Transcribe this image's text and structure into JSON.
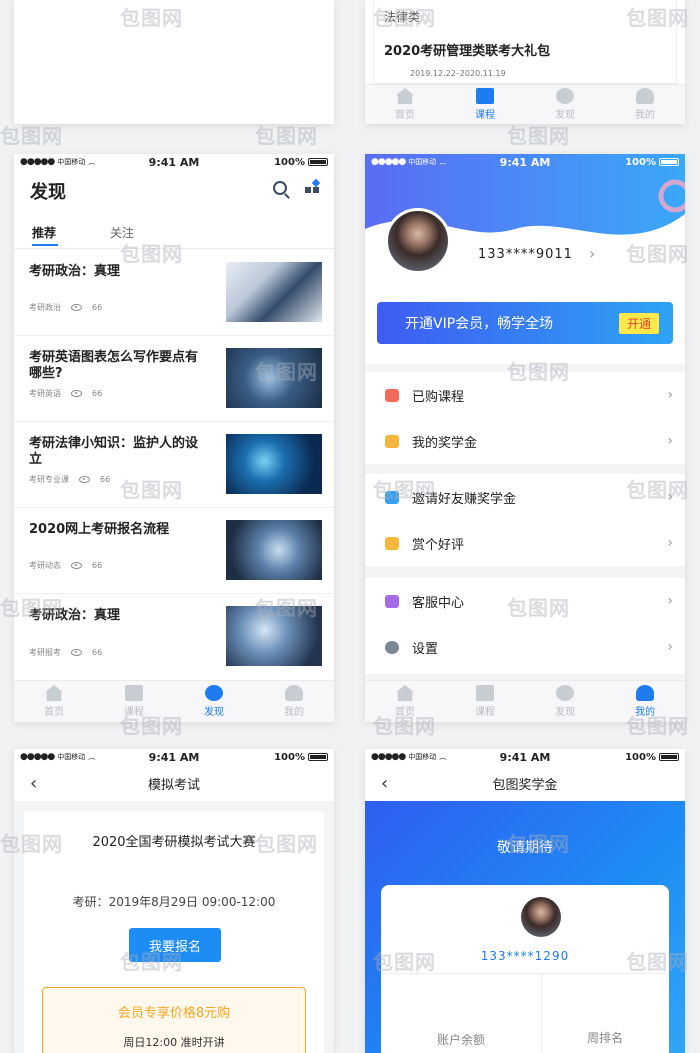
{
  "watermark": "包图网",
  "status": {
    "carrier": "中国移动",
    "time": "9:41 AM",
    "battery": "100%"
  },
  "tabs": [
    "首页",
    "课程",
    "发现",
    "我的"
  ],
  "panel_top_right": {
    "category": "法律类",
    "title": "2020考研管理类联考大礼包",
    "dates": "2019.12.22–2020.11.19"
  },
  "discover": {
    "title": "发现",
    "tabs": [
      "推荐",
      "关注"
    ],
    "articles": [
      {
        "title": "考研政治：真理",
        "tag": "考研政治",
        "views": "66"
      },
      {
        "title": "考研英语图表怎么写作要点有哪些?",
        "tag": "考研英语",
        "views": "66"
      },
      {
        "title": "考研法律小知识：监护人的设立",
        "tag": "考研专业课",
        "views": "66"
      },
      {
        "title": "2020网上考研报名流程",
        "tag": "考研动态",
        "views": "66"
      },
      {
        "title": "考研政治：真理",
        "tag": "考研报考",
        "views": "66"
      }
    ]
  },
  "profile": {
    "phone": "133****9011",
    "vip_text": "开通VIP会员，畅学全场",
    "vip_button": "开通",
    "menu": [
      {
        "label": "已购课程",
        "icon": "book-icon",
        "color": "#f26b5b"
      },
      {
        "label": "我的奖学金",
        "icon": "graduation-cap-icon",
        "color": "#f4b63d"
      },
      {
        "label": "邀请好友赚奖学金",
        "icon": "gift-icon",
        "color": "#3aa0f0"
      },
      {
        "label": "赏个好评",
        "icon": "thumb-up-icon",
        "color": "#f4b63d"
      },
      {
        "label": "客服中心",
        "icon": "headset-icon",
        "color": "#a66be8"
      },
      {
        "label": "设置",
        "icon": "gear-icon",
        "color": "#7c8694"
      }
    ]
  },
  "exam": {
    "nav_title": "模拟考试",
    "title": "2020全国考研模拟考试大赛",
    "date_line": "考研：2019年8月29日 09:00-12:00",
    "signup": "我要报名",
    "member_price": "会员专享价格8元购",
    "open_time": "周日12:00 准时开讲"
  },
  "scholarship": {
    "nav_title": "包图奖学金",
    "banner": "敬请期待",
    "phone": "133****1290",
    "stats": [
      "账户余额",
      "周排名"
    ]
  },
  "colors": {
    "accent": "#1e7cf0",
    "vip_yellow": "#ffe94a",
    "orange": "#f5a623"
  }
}
